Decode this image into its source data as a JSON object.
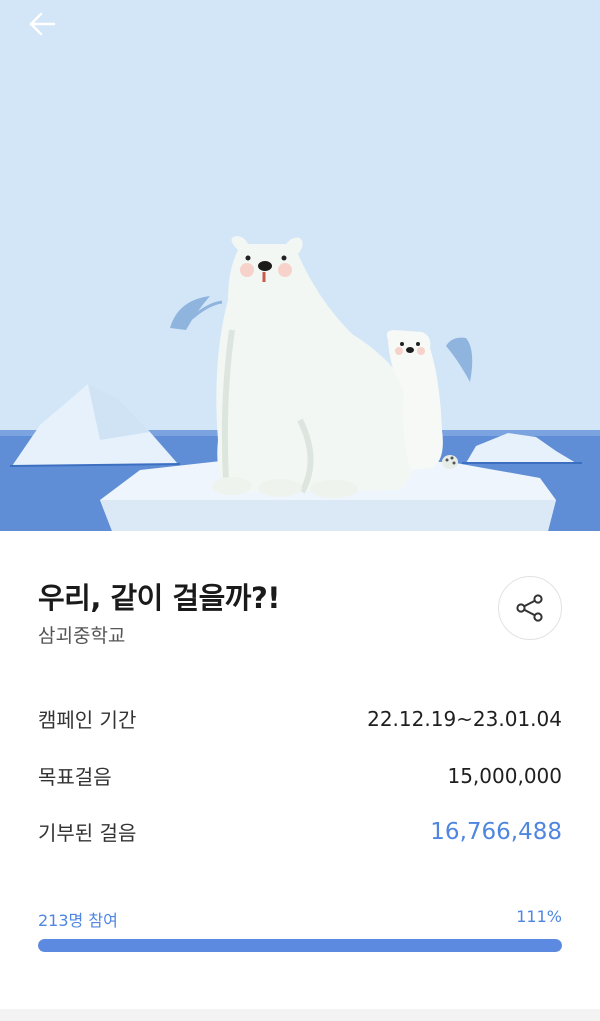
{
  "header": {
    "back_icon": "arrow-left-icon"
  },
  "hero": {
    "illustration": "polar-bears-on-ice"
  },
  "campaign": {
    "title": "우리, 같이 걸을까?!",
    "organization": "삼괴중학교",
    "share_icon": "share-icon"
  },
  "details": [
    {
      "label": "캠페인 기간",
      "value": "22.12.19~23.01.04"
    },
    {
      "label": "목표걸음",
      "value": "15,000,000"
    },
    {
      "label": "기부된 걸음",
      "value": "16,766,488"
    }
  ],
  "progress": {
    "participants": "213명 참여",
    "percent_text": "111%",
    "fill_fraction": 1.0
  },
  "colors": {
    "accent": "#4f86e0",
    "sky": "#d3e6f7",
    "sea": "#5f8ed6"
  }
}
